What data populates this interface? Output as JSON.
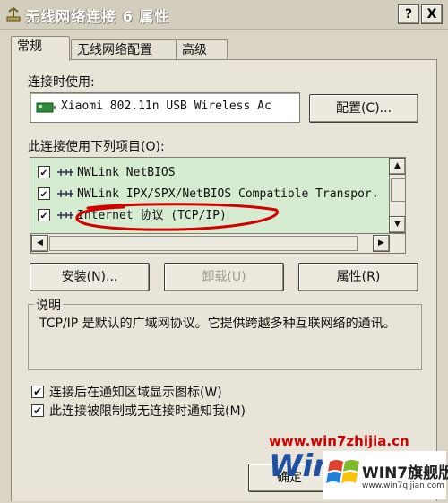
{
  "window": {
    "title": "无线网络连接 6 属性",
    "help_label": "?",
    "close_label": "X"
  },
  "tabs": [
    {
      "label": "常规"
    },
    {
      "label": "无线网络配置"
    },
    {
      "label": "高级"
    }
  ],
  "connect_using": {
    "label": "连接时使用:",
    "device_name": "Xiaomi 802.11n USB Wireless Ac",
    "configure_label": "配置(C)..."
  },
  "items_list": {
    "label": "此连接使用下列项目(O):",
    "items": [
      {
        "label": "NWLink NetBIOS",
        "checked": true
      },
      {
        "label": "NWLink IPX/SPX/NetBIOS Compatible Transpor.",
        "checked": true
      },
      {
        "label": "Internet 协议 (TCP/IP)",
        "checked": true
      }
    ]
  },
  "buttons": {
    "install": "安装(N)...",
    "uninstall": "卸载(U)",
    "properties": "属性(R)",
    "ok": "确定"
  },
  "description": {
    "title": "说明",
    "text": "TCP/IP 是默认的广域网协议。它提供跨越多种互联网络的通讯。"
  },
  "options": [
    {
      "label": "连接后在通知区域显示图标(W)",
      "checked": true
    },
    {
      "label": "此连接被限制或无连接时通知我(M)",
      "checked": true
    }
  ],
  "watermark": {
    "url": "www.win7zhijia.cn",
    "brand": "WIN7旗舰版",
    "brand_url": "www.win7qijian.com",
    "logo_text": "Win"
  },
  "colors": {
    "annotation": "#d40000",
    "list_bg": "#d6ecd0"
  }
}
